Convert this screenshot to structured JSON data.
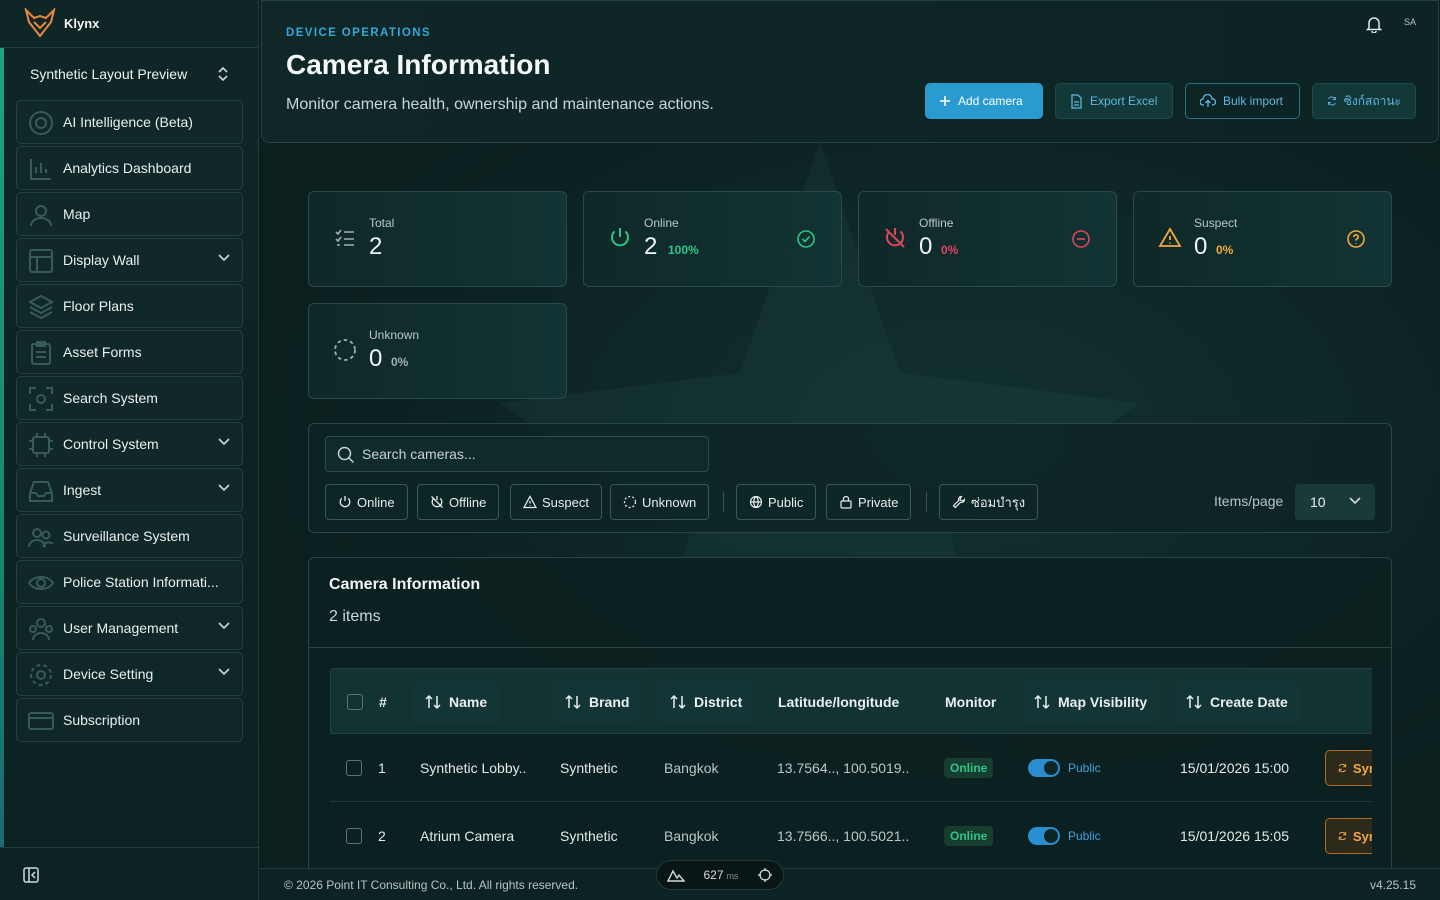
{
  "app": {
    "name": "Klynx"
  },
  "sidebar": {
    "workspace": "Synthetic Layout Preview",
    "items": [
      {
        "label": "AI Intelligence (Beta)",
        "icon": "ai-target-icon",
        "expandable": false
      },
      {
        "label": "Analytics Dashboard",
        "icon": "chart-icon",
        "expandable": false
      },
      {
        "label": "Map",
        "icon": "user-pin-icon",
        "expandable": false
      },
      {
        "label": "Display Wall",
        "icon": "grid-icon",
        "expandable": true
      },
      {
        "label": "Floor Plans",
        "icon": "layers-icon",
        "expandable": false
      },
      {
        "label": "Asset Forms",
        "icon": "clipboard-icon",
        "expandable": false
      },
      {
        "label": "Search System",
        "icon": "scan-icon",
        "expandable": false
      },
      {
        "label": "Control System",
        "icon": "chip-icon",
        "expandable": true
      },
      {
        "label": "Ingest",
        "icon": "inbox-icon",
        "expandable": true
      },
      {
        "label": "Surveillance System",
        "icon": "users-icon",
        "expandable": false
      },
      {
        "label": "Police Station Informati...",
        "icon": "eye-icon",
        "expandable": false
      },
      {
        "label": "User Management",
        "icon": "team-icon",
        "expandable": true
      },
      {
        "label": "Device Setting",
        "icon": "gear-icon",
        "expandable": true
      },
      {
        "label": "Subscription",
        "icon": "card-icon",
        "expandable": false
      }
    ]
  },
  "header": {
    "eyebrow": "DEVICE OPERATIONS",
    "title": "Camera Information",
    "subtitle": "Monitor camera health, ownership and maintenance actions.",
    "avatar": "SA",
    "buttons": {
      "add": "Add camera",
      "export": "Export Excel",
      "bulk": "Bulk import",
      "sync": "ซิงก์สถานะ"
    }
  },
  "stats": [
    {
      "label": "Total",
      "value": "2",
      "pct": "",
      "color": "#9fb1b1"
    },
    {
      "label": "Online",
      "value": "2",
      "pct": "100%",
      "color": "#2fc486"
    },
    {
      "label": "Offline",
      "value": "0",
      "pct": "0%",
      "color": "#e0455e"
    },
    {
      "label": "Suspect",
      "value": "0",
      "pct": "0%",
      "color": "#f2a93b"
    },
    {
      "label": "Unknown",
      "value": "0",
      "pct": "0%",
      "color": "#9fb1b1"
    }
  ],
  "filters": {
    "search_placeholder": "Search cameras...",
    "chips": {
      "online": "Online",
      "offline": "Offline",
      "suspect": "Suspect",
      "unknown": "Unknown",
      "public": "Public",
      "private": "Private",
      "maintenance": "ซ่อมบำรุง"
    },
    "items_per_page_label": "Items/page",
    "items_per_page": "10"
  },
  "table": {
    "title": "Camera Information",
    "count": "2 items",
    "columns": {
      "index": "#",
      "name": "Name",
      "brand": "Brand",
      "district": "District",
      "latlng": "Latitude/longitude",
      "monitor": "Monitor",
      "visibility": "Map Visibility",
      "created": "Create Date"
    },
    "rows": [
      {
        "index": "1",
        "name": "Synthetic Lobby..",
        "brand": "Synthetic",
        "district": "Bangkok",
        "latlng": "13.7564.., 100.5019..",
        "monitor": "Online",
        "visibility": "Public",
        "created": "15/01/2026 15:00",
        "action": "Sync"
      },
      {
        "index": "2",
        "name": "Atrium Camera",
        "brand": "Synthetic",
        "district": "Bangkok",
        "latlng": "13.7566.., 100.5021..",
        "monitor": "Online",
        "visibility": "Public",
        "created": "15/01/2026 15:05",
        "action": "Sync"
      }
    ]
  },
  "footer": {
    "copyright": "© 2026 Point IT Consulting Co., Ltd. All rights reserved.",
    "version": "v4.25.15",
    "latency": "627",
    "latency_unit": "ms"
  }
}
